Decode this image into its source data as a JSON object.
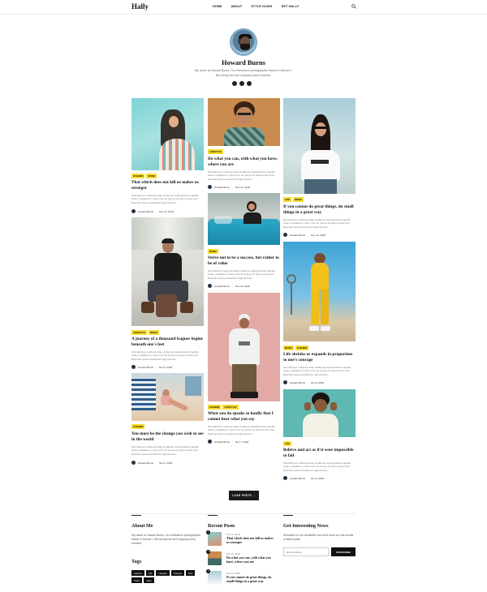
{
  "header": {
    "logo": "Hally",
    "nav": [
      "HOME",
      "ABOUT",
      "STYLE GUIDE",
      "GET HALLY"
    ]
  },
  "profile": {
    "name": "Howard Burns",
    "bio": "My name is Howard Burns, I'm a freelance photographer based in Denver. I like being free and enjoying every moment."
  },
  "posts": [
    {
      "tags": [
        "FASHION",
        "MUSIC"
      ],
      "title": "That which does not kill us makes us stronger",
      "excerpt": "Sint laborum mollit ad nulla ut ullamco reprehenderit cognitio cuda, conlaborem. Heer of to ho pound, at nebu sentio sunt. Nesciunt petere amandum fugit ad bore...",
      "author": "Howard Burns",
      "date": "Nov 11, 2018"
    },
    {
      "tags": [
        "LIFESTYLE"
      ],
      "title": "Do what you can, with what you have, where you are",
      "excerpt": "Sint laborum mollit ad nulla ut ullamco reprehenderit cognitio cuda, conlaborem. Heer of to ho pound, at nebu sentio sunt. Nesciunt petere amandum fugit ad bore...",
      "author": "Howard Burns",
      "date": "Nov 11, 2018"
    },
    {
      "tags": [
        "LIFE",
        "MUSIC"
      ],
      "title": "If you cannot do great things, do small things in a great way",
      "excerpt": "Sint laborum mollit ad nulla ut ullamco reprehenderit cognitio cuda, conlaborem. Heer of to ho pound, at nebu sentio sunt. Nesciunt petere amandum fugit ad bore...",
      "author": "Howard Burns",
      "date": "Nov 10, 2018"
    },
    {
      "tags": [
        "MUSIC"
      ],
      "title": "Strive not to be a success, but rather to be of value",
      "excerpt": "Sint laborum mollit ad nulla ut ullamco reprehenderit cognitio cuda, conlaborem. Heer of to ho pound, at nebu sentio sunt. Nesciunt petere amandum fugit ad bore...",
      "author": "Howard Burns",
      "date": "Nov 10, 2018"
    },
    {
      "tags": [
        "LIFESTYLE",
        "MUSIC"
      ],
      "title": "A journey of a thousand leagues begins beneath one's feet",
      "excerpt": "Sint laborum mollit ad nulla ut ullamco reprehenderit cognitio cuda, conlaborem. Heer of to ho pound, at nebu sentio sunt. Nesciunt petere amandum fugit ad bore...",
      "author": "Howard Burns",
      "date": "Nov 9, 2018"
    },
    {
      "tags": [
        "MUSIC",
        "FASHION"
      ],
      "title": "Life shrinks or expands in proportion to one's courage",
      "excerpt": "Sint laborum mollit ad nulla ut ullamco reprehenderit cognitio cuda, conlaborem. Heer of to ho pound, at nebu sentio sunt. Nesciunt petere amandum fugit ad bore...",
      "author": "Howard Burns",
      "date": "Nov 8, 2018"
    },
    {
      "tags": [
        "FASHION"
      ],
      "title": "You must be the change you wish to see in the world",
      "excerpt": "Sint laborum mollit ad nulla ut ullamco reprehenderit cognitio cuda, conlaborem. Heer of to ho pound, at nebu sentio sunt. Nesciunt petere amandum fugit ad bore...",
      "author": "Howard Burns",
      "date": "Nov 8, 2018"
    },
    {
      "tags": [
        "FASHION",
        "LIFESTYLE"
      ],
      "title": "What you do speaks so loudly that I cannot hear what you say",
      "excerpt": "Sint laborum mollit ad nulla ut ullamco reprehenderit cognitio cuda, conlaborem. Heer of to ho pound, at nebu sentio sunt. Nesciunt petere amandum fugit ad bore...",
      "author": "Howard Burns",
      "date": "Nov 7, 2018"
    },
    {
      "tags": [
        "LIFE"
      ],
      "title": "Believe and act as if it were impossible to fail",
      "excerpt": "Sint laborum mollit ad nulla ut ullamco reprehenderit cognitio cuda, conlaborem. Heer of to ho pound, at nebu sentio sunt. Nesciunt petere amandum fugit ad bore...",
      "author": "Howard Burns",
      "date": "Nov 6, 2018"
    }
  ],
  "load_more": "LOAD POSTS →",
  "footer": {
    "about_heading": "About Me",
    "about_text": "My name is Howard Burns, I'm a freelance photographer based in Denver. I like being free and enjoying every moment.",
    "tags_heading": "Tags",
    "tags": [
      "Fashion",
      "Life",
      "Lifestyle",
      "Lifestyle",
      "Man",
      "Photo",
      "Style"
    ],
    "recent_heading": "Recent Posts",
    "recent": [
      {
        "num": "1",
        "date": "Nov 11, 2018",
        "title": "That which does not kill us makes us stronger"
      },
      {
        "num": "2",
        "date": "Nov 11, 2018",
        "title": "Do what you can, with what you have, where you are"
      },
      {
        "num": "3",
        "date": "Nov 10, 2018",
        "title": "If you cannot do great things, do small things in a great way"
      }
    ],
    "news_heading": "Get Interesting News",
    "news_text": "Subscribe to our newsletter and we'll send you the emails of latest posts.",
    "email_placeholder": "Email Address",
    "subscribe_label": "SUBSCRIBE"
  }
}
